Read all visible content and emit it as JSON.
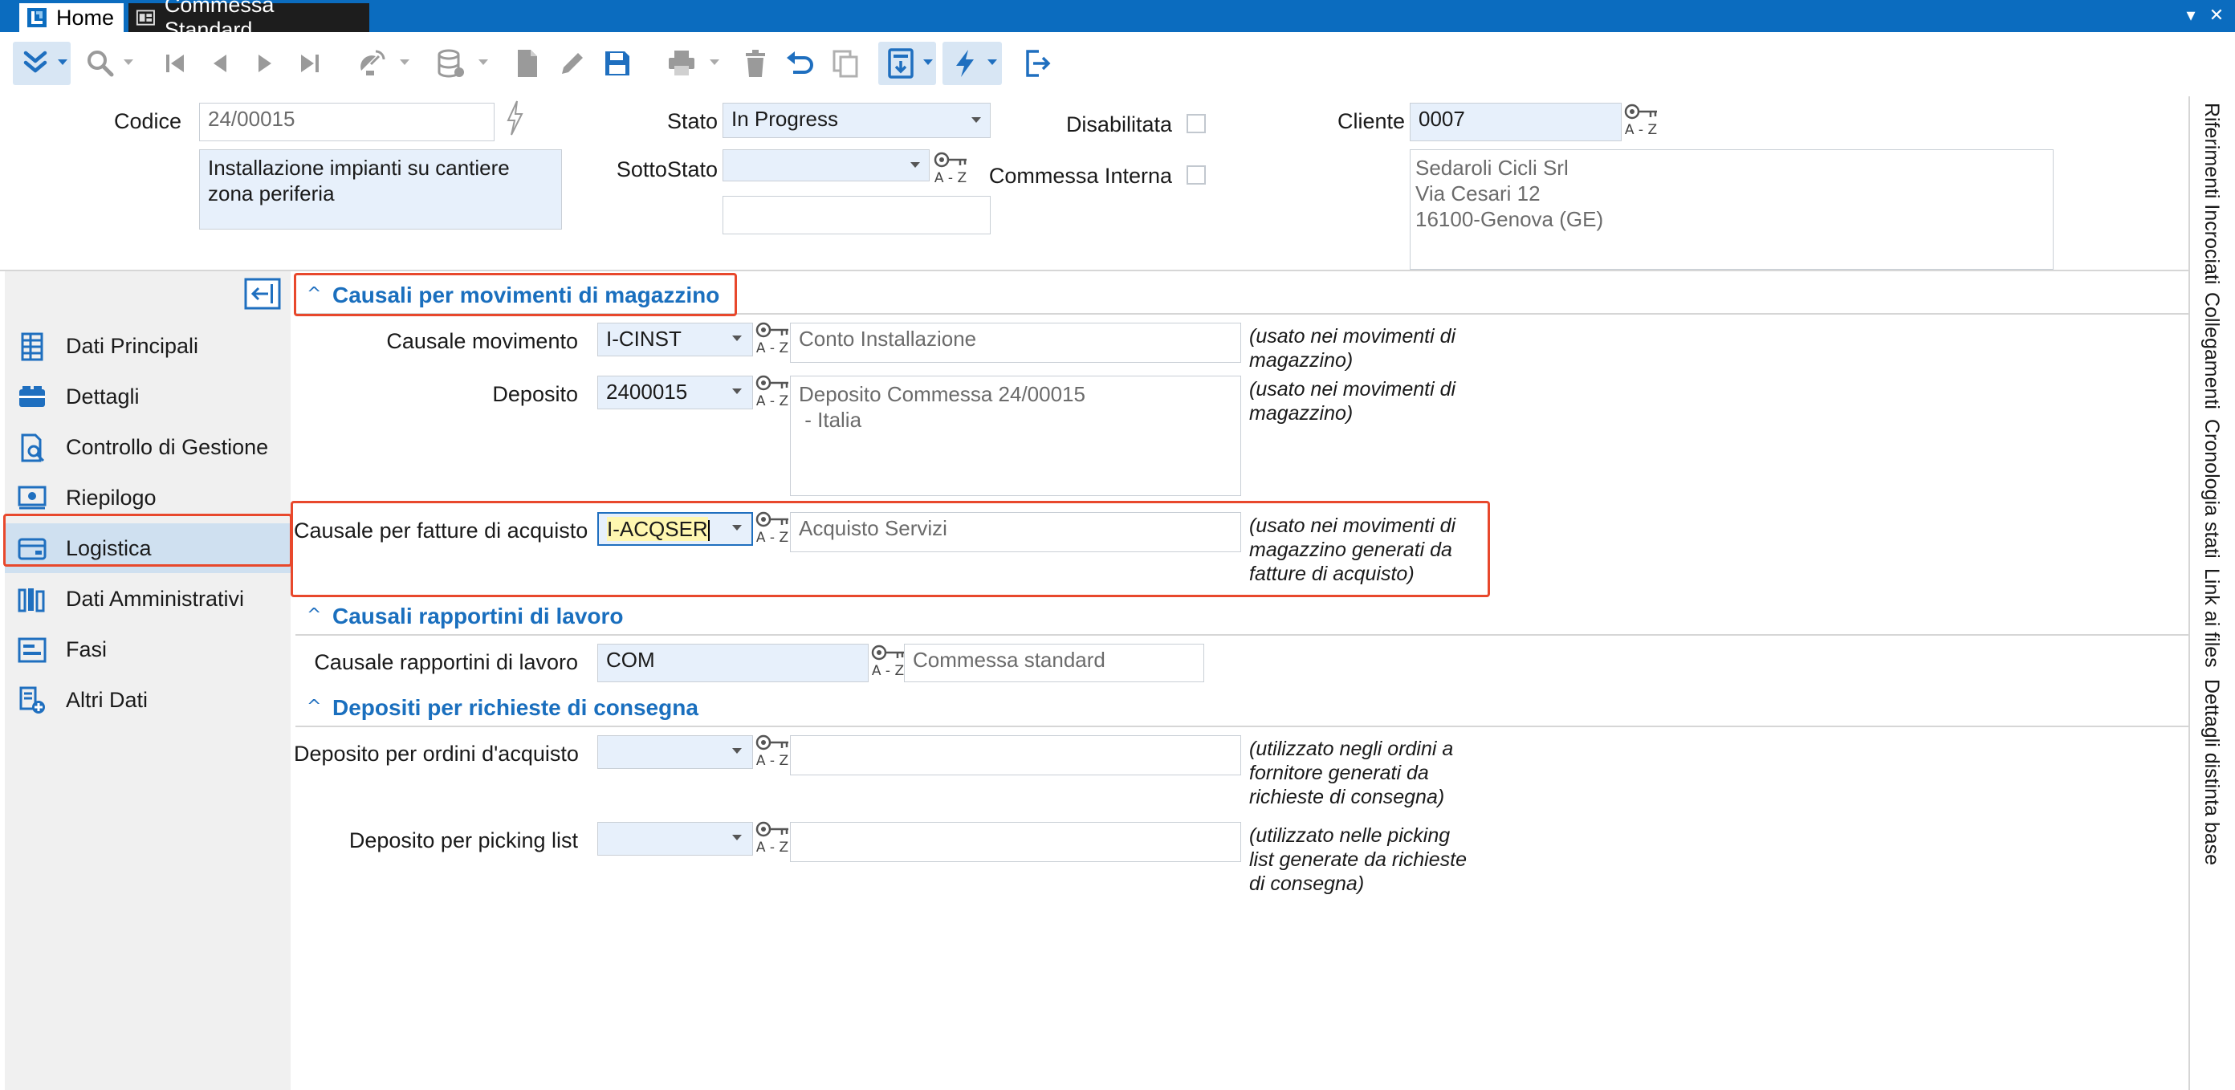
{
  "window": {
    "tabs": [
      {
        "label": "Home"
      },
      {
        "label": "Commessa Standard"
      }
    ]
  },
  "toolbar": {
    "icons": [
      "chevrons-down-icon",
      "search-icon",
      "first-record-icon",
      "previous-record-icon",
      "next-record-icon",
      "last-record-icon",
      "satellite-icon",
      "database-icon",
      "new-document-icon",
      "edit-icon",
      "save-icon",
      "print-icon",
      "delete-icon",
      "undo-icon",
      "copy-icon",
      "archive-icon",
      "lightning-icon",
      "exit-icon"
    ]
  },
  "header": {
    "codice_label": "Codice",
    "codice_value": "24/00015",
    "descrizione": "Installazione impianti su cantiere zona periferia",
    "stato_label": "Stato",
    "stato_value": "In Progress",
    "sottostato_label": "SottoStato",
    "sottostato_value": "",
    "disabilitata_label": "Disabilitata",
    "commessa_interna_label": "Commessa Interna",
    "cliente_label": "Cliente",
    "cliente_value": "0007",
    "cliente_address": [
      "Sedaroli Cicli Srl",
      "Via Cesari 12",
      "16100-Genova (GE)"
    ],
    "az_text": "A - Z"
  },
  "sidebar": {
    "items": [
      {
        "label": "Dati Principali",
        "icon": "table-icon"
      },
      {
        "label": "Dettagli",
        "icon": "details-icon"
      },
      {
        "label": "Controllo di Gestione",
        "icon": "control-icon"
      },
      {
        "label": "Riepilogo",
        "icon": "summary-icon"
      },
      {
        "label": "Logistica",
        "icon": "logistics-icon",
        "active": true
      },
      {
        "label": "Dati Amministrativi",
        "icon": "admin-icon"
      },
      {
        "label": "Fasi",
        "icon": "phases-icon"
      },
      {
        "label": "Altri Dati",
        "icon": "other-data-icon"
      }
    ]
  },
  "sections": {
    "magazzino": {
      "title": "Causali per movimenti di magazzino",
      "causale_movimento_label": "Causale movimento",
      "causale_movimento_value": "I-CINST",
      "causale_movimento_desc": "Conto Installazione",
      "causale_movimento_note": "(usato nei movimenti di magazzino)",
      "deposito_label": "Deposito",
      "deposito_value": "2400015",
      "deposito_desc": "Deposito Commessa 24/00015\n - Italia",
      "deposito_note": "(usato nei movimenti di magazzino)",
      "fatture_label": "Causale per fatture di acquisto",
      "fatture_value": "I-ACQSER",
      "fatture_desc": "Acquisto Servizi",
      "fatture_note": "(usato nei movimenti di magazzino generati da fatture di acquisto)"
    },
    "rapportini": {
      "title": "Causali rapportini di lavoro",
      "label": "Causale rapportini di lavoro",
      "value": "COM",
      "desc": "Commessa standard"
    },
    "depositi": {
      "title": "Depositi per richieste di consegna",
      "ordini_label": "Deposito per ordini d'acquisto",
      "ordini_value": "",
      "ordini_note": "(utilizzato negli ordini a fornitore generati da richieste di consegna)",
      "picking_label": "Deposito per picking list",
      "picking_value": "",
      "picking_note": "(utilizzato nelle picking list generate da richieste di consegna)"
    }
  },
  "right_tabs": [
    "Riferimenti Incrociati",
    "Collegamenti",
    "Cronologia stati",
    "Link ai files",
    "Dettagli distinta base"
  ],
  "colors": {
    "accent": "#1a6fbe",
    "highlight": "#e8482c",
    "field_bg": "#e7f0fb",
    "titlebar": "#0b6cbf"
  }
}
